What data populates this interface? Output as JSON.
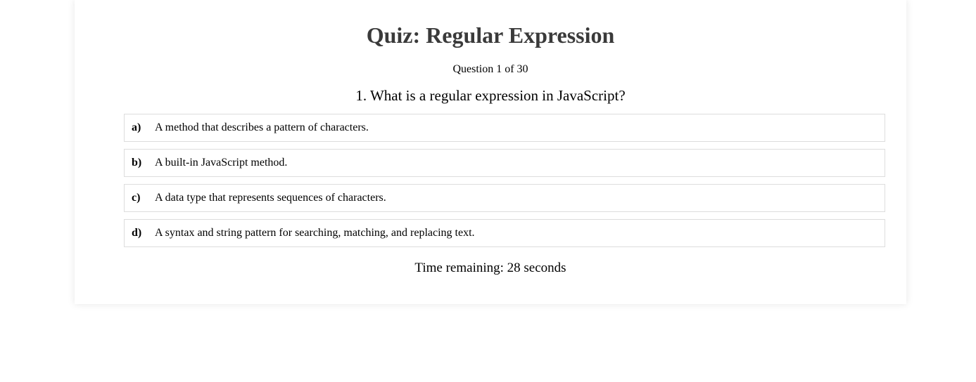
{
  "quiz": {
    "title": "Quiz: Regular Expression",
    "counter": "Question 1 of 30",
    "question": "1. What is a regular expression in JavaScript?",
    "options": [
      {
        "letter": "a)",
        "text": "A method that describes a pattern of characters."
      },
      {
        "letter": "b)",
        "text": "A built-in JavaScript method."
      },
      {
        "letter": "c)",
        "text": "A data type that represents sequences of characters."
      },
      {
        "letter": "d)",
        "text": "A syntax and string pattern for searching, matching, and replacing text."
      }
    ],
    "timer": "Time remaining: 28 seconds"
  },
  "colors": {
    "title": "#3a3a3a",
    "option_border": "#dddddd",
    "background": "#ffffff"
  }
}
